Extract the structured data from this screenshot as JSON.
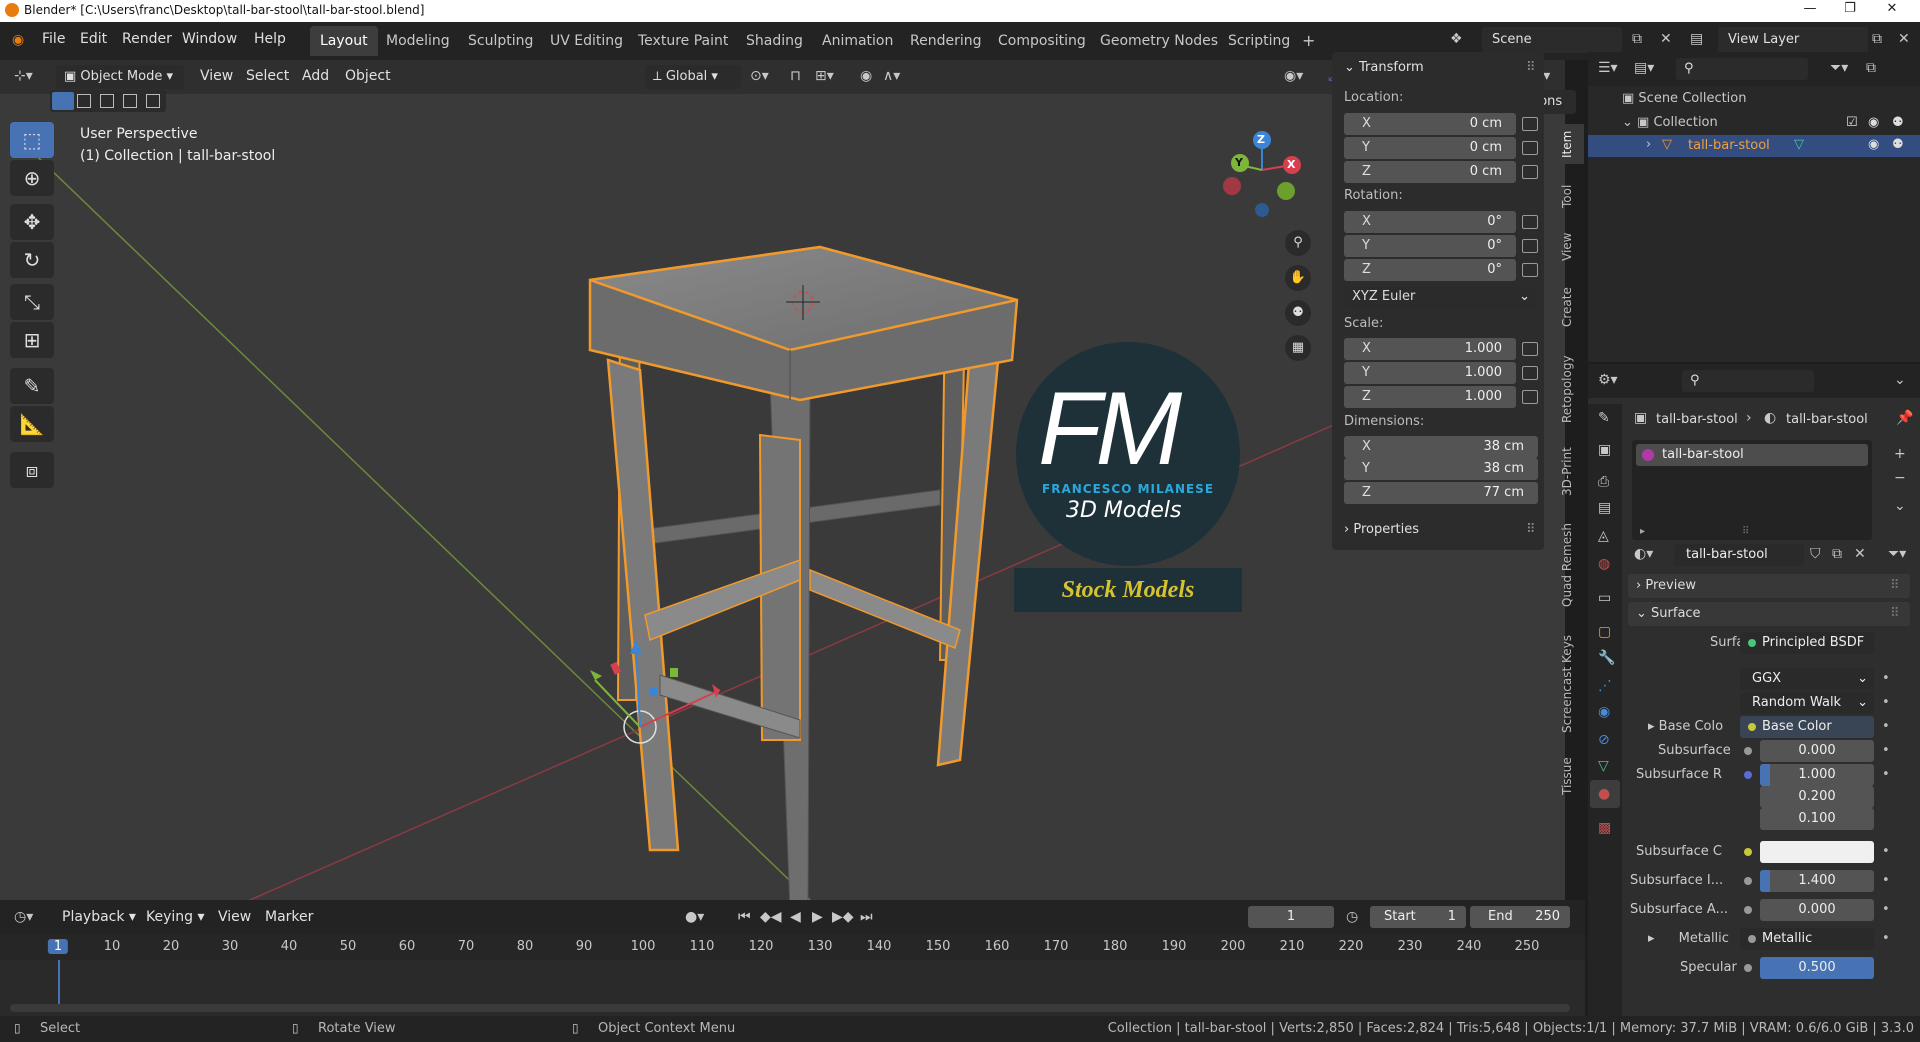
{
  "window": {
    "title": "Blender* [C:\\Users\\franc\\Desktop\\tall-bar-stool\\tall-bar-stool.blend]",
    "minimize": "—",
    "maximize": "❐",
    "close": "✕"
  },
  "menu": [
    "File",
    "Edit",
    "Render",
    "Window",
    "Help"
  ],
  "workspaces": [
    "Layout",
    "Modeling",
    "Sculpting",
    "UV Editing",
    "Texture Paint",
    "Shading",
    "Animation",
    "Rendering",
    "Compositing",
    "Geometry Nodes",
    "Scripting"
  ],
  "active_workspace": "Layout",
  "scene": {
    "label": "Scene",
    "view_layer": "View Layer"
  },
  "viewport": {
    "mode": "Object Mode",
    "menus": [
      "View",
      "Select",
      "Add",
      "Object"
    ],
    "orientation": "Global",
    "options": "Options",
    "perspective": "User Perspective",
    "collection_info": "(1) Collection | tall-bar-stool",
    "gizmo_axes": {
      "x": "X",
      "y": "Y",
      "z": "Z"
    }
  },
  "logo": {
    "letters": "FM",
    "name": "FRANCESCO MILANESE",
    "subtitle": "3D Models",
    "banner": "Stock Models"
  },
  "transform": {
    "header": "Transform",
    "location_label": "Location:",
    "location": [
      {
        "axis": "X",
        "value": "0 cm"
      },
      {
        "axis": "Y",
        "value": "0 cm"
      },
      {
        "axis": "Z",
        "value": "0 cm"
      }
    ],
    "rotation_label": "Rotation:",
    "rotation": [
      {
        "axis": "X",
        "value": "0°"
      },
      {
        "axis": "Y",
        "value": "0°"
      },
      {
        "axis": "Z",
        "value": "0°"
      }
    ],
    "rotation_mode": "XYZ Euler",
    "scale_label": "Scale:",
    "scale": [
      {
        "axis": "X",
        "value": "1.000"
      },
      {
        "axis": "Y",
        "value": "1.000"
      },
      {
        "axis": "Z",
        "value": "1.000"
      }
    ],
    "dimensions_label": "Dimensions:",
    "dimensions": [
      {
        "axis": "X",
        "value": "38 cm"
      },
      {
        "axis": "Y",
        "value": "38 cm"
      },
      {
        "axis": "Z",
        "value": "77 cm"
      }
    ],
    "properties": "Properties"
  },
  "side_tabs": [
    "Item",
    "Tool",
    "View",
    "Create",
    "Retopology",
    "3D-Print",
    "Quad Remesh",
    "Screencast Keys",
    "Tissue"
  ],
  "outliner": {
    "root": "Scene Collection",
    "collection": "Collection",
    "object": "tall-bar-stool"
  },
  "properties": {
    "breadcrumb_object": "tall-bar-stool",
    "breadcrumb_material": "tall-bar-stool",
    "slot": "tall-bar-stool",
    "material_name": "tall-bar-stool",
    "preview": "Preview",
    "surface_section": "Surface",
    "surface_label": "Surface",
    "surface_value": "Principled BSDF",
    "distribution": "GGX",
    "subsurface_method": "Random Walk",
    "base_color_label": "Base Colo",
    "base_color_value": "Base Color",
    "subsurface_label": "Subsurface",
    "subsurface_value": "0.000",
    "subsurface_r_label": "Subsurface R",
    "subsurface_r": [
      "1.000",
      "0.200",
      "0.100"
    ],
    "subsurface_c_label": "Subsurface C",
    "subsurface_i_label": "Subsurface I...",
    "subsurface_i_value": "1.400",
    "subsurface_a_label": "Subsurface A...",
    "subsurface_a_value": "0.000",
    "metallic_label": "Metallic",
    "metallic_value": "Metallic",
    "specular_label": "Specular",
    "specular_value": "0.500"
  },
  "timeline": {
    "menus": [
      "Playback",
      "Keying",
      "View",
      "Marker"
    ],
    "current_frame": "1",
    "start_label": "Start",
    "start": "1",
    "end_label": "End",
    "end": "250",
    "ruler": [
      "1",
      "10",
      "20",
      "30",
      "40",
      "50",
      "60",
      "70",
      "80",
      "90",
      "100",
      "110",
      "120",
      "130",
      "140",
      "150",
      "160",
      "170",
      "180",
      "190",
      "200",
      "210",
      "220",
      "230",
      "240",
      "250"
    ]
  },
  "status": {
    "select": "Select",
    "rotate": "Rotate View",
    "context": "Object Context Menu",
    "info": "Collection | tall-bar-stool | Verts:2,850 | Faces:2,824 | Tris:5,648 | Objects:1/1 | Memory: 37.7 MiB | VRAM: 0.6/6.0 GiB | 3.3.0"
  },
  "colors": {
    "accent": "#4772b3",
    "selection": "#f0992c",
    "x_axis": "#d63f4e",
    "y_axis": "#7eb63a",
    "z_axis": "#3a85d6"
  }
}
